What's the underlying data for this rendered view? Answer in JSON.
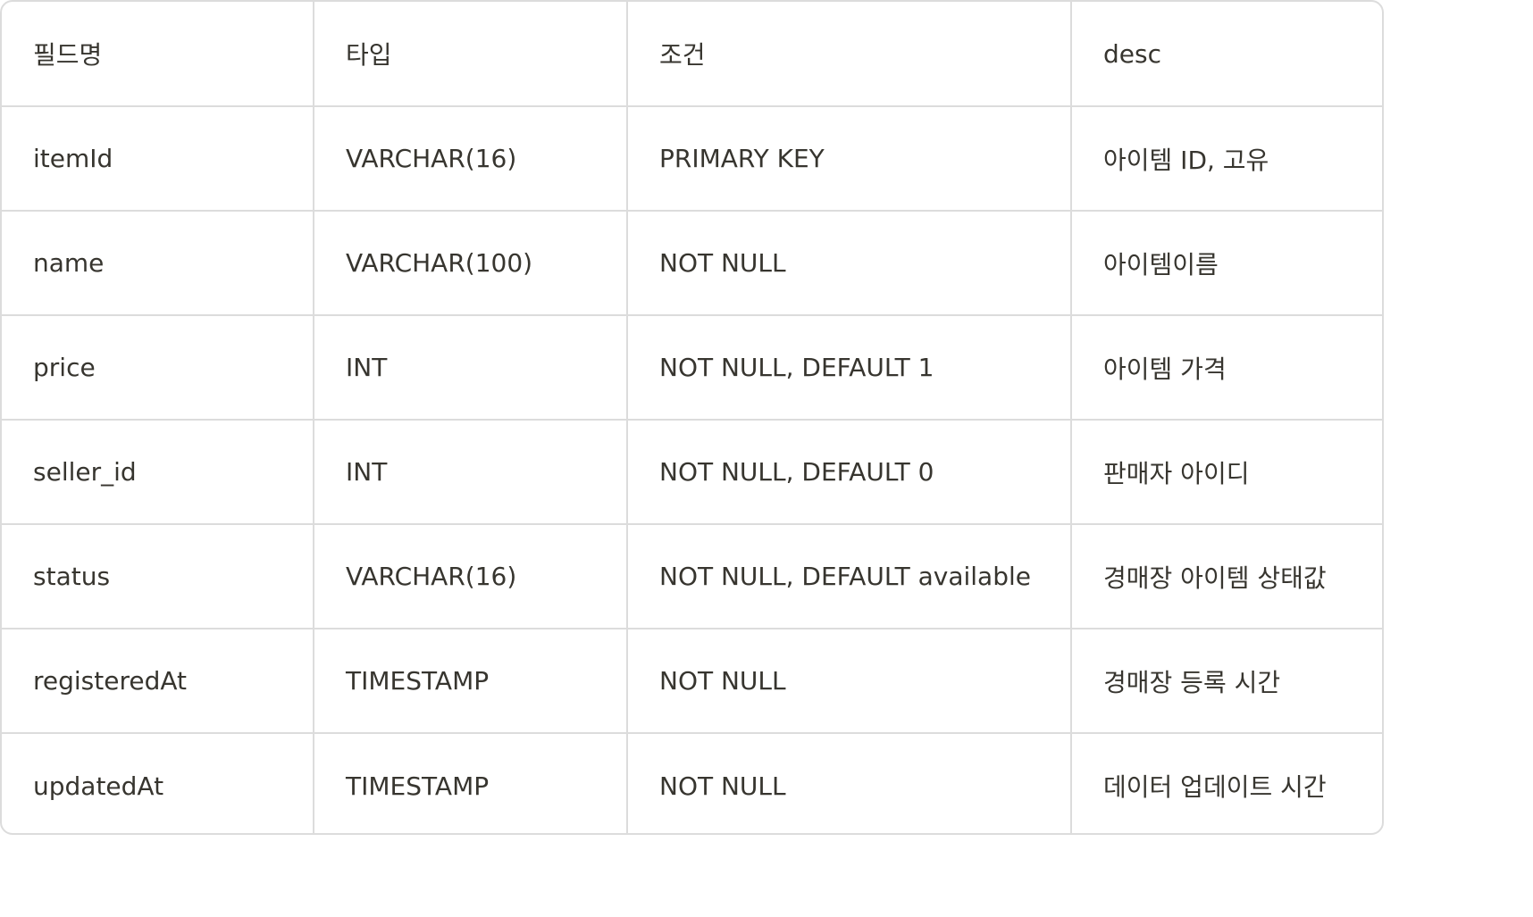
{
  "table": {
    "headers": [
      "필드명",
      "타입",
      "조건",
      "desc"
    ],
    "rows": [
      [
        "itemId",
        "VARCHAR(16)",
        "PRIMARY KEY",
        "아이템 ID, 고유"
      ],
      [
        "name",
        "VARCHAR(100)",
        "NOT NULL",
        "아이템이름"
      ],
      [
        "price",
        "INT",
        "NOT NULL, DEFAULT 1",
        "아이템 가격"
      ],
      [
        "seller_id",
        "INT",
        "NOT NULL, DEFAULT 0",
        "판매자 아이디"
      ],
      [
        "status",
        "VARCHAR(16)",
        "NOT NULL, DEFAULT available",
        "경매장 아이템 상태값"
      ],
      [
        "registeredAt",
        "TIMESTAMP",
        "NOT NULL",
        "경매장 등록 시간"
      ],
      [
        "updatedAt",
        "TIMESTAMP",
        "NOT NULL",
        "데이터 업데이트 시간"
      ]
    ]
  }
}
